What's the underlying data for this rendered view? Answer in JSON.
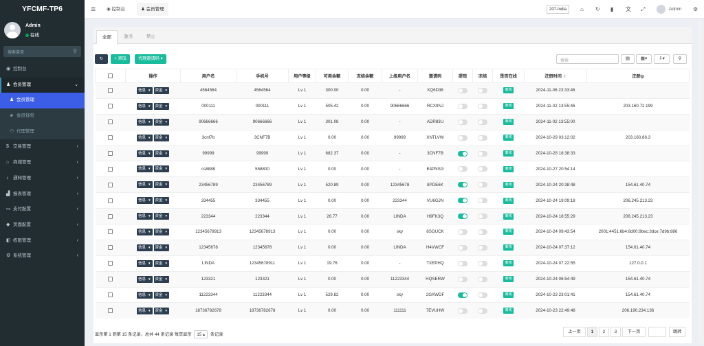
{
  "brand": "YFCMF-TP6",
  "user": {
    "name": "Admin",
    "status": "在线"
  },
  "sidebar_search": {
    "placeholder": "搜索菜单"
  },
  "menu": [
    {
      "label": "控制台",
      "icon": "dashboard-icon",
      "type": "top"
    },
    {
      "label": "会员管理",
      "icon": "user-icon",
      "type": "open"
    },
    {
      "label": "会员管理",
      "icon": "user-icon",
      "type": "active"
    },
    {
      "label": "会员钱包",
      "icon": "wallet-icon",
      "type": "sub"
    },
    {
      "label": "代理管理",
      "icon": "agent-icon",
      "type": "sub"
    },
    {
      "label": "交易管理",
      "icon": "trade-icon",
      "type": "top"
    },
    {
      "label": "商城管理",
      "icon": "shop-icon",
      "type": "top"
    },
    {
      "label": "通知管理",
      "icon": "bell-icon",
      "type": "top"
    },
    {
      "label": "报表管理",
      "icon": "chart-icon",
      "type": "top"
    },
    {
      "label": "支付配置",
      "icon": "pay-icon",
      "type": "top"
    },
    {
      "label": "页面配置",
      "icon": "page-icon",
      "type": "top"
    },
    {
      "label": "权限管理",
      "icon": "lock-icon",
      "type": "top"
    },
    {
      "label": "系统管理",
      "icon": "gear-icon",
      "type": "top"
    }
  ],
  "topbar": {
    "dashboard": "控制台",
    "current_tab": "会员管理",
    "lang": "207-India",
    "admin": "Admin"
  },
  "tabs": [
    "全部",
    "激活",
    "禁止"
  ],
  "toolbar": {
    "add": "+ 添加",
    "invite": "代理邀请码",
    "search_placeholder": "搜索"
  },
  "columns": [
    "操作",
    "用户名",
    "手机号",
    "用户等级",
    "可用余额",
    "冻结余额",
    "上级用户名",
    "邀请码",
    "提现",
    "冻结",
    "是否在线",
    "注册时间",
    "注册ip"
  ],
  "action_labels": {
    "info": "信息",
    "fund": "资金"
  },
  "online_label": "离线",
  "rows": [
    {
      "username": "4564564",
      "phone": "4564564",
      "level": "Lv 1",
      "balance": "300.00",
      "frozen": "0.00",
      "parent": "-",
      "code": "XQ6D38",
      "withdraw": false,
      "freeze": false,
      "time": "2024-11-06 23:33:46",
      "ip": ""
    },
    {
      "username": "000111",
      "phone": "000111",
      "level": "Lv 1",
      "balance": "505.42",
      "frozen": "0.00",
      "parent": "90666666",
      "code": "RCX9NJ",
      "withdraw": false,
      "freeze": false,
      "time": "2024-11-02 13:55:46",
      "ip": "203.160.72.199"
    },
    {
      "username": "90666666",
      "phone": "90666666",
      "level": "Lv 1",
      "balance": "301.08",
      "frozen": "0.00",
      "parent": "-",
      "code": "ADR83U",
      "withdraw": false,
      "freeze": false,
      "time": "2024-11-02 13:55:00",
      "ip": ""
    },
    {
      "username": "3cnf7b",
      "phone": "3CNF7B",
      "level": "Lv 1",
      "balance": "0.00",
      "frozen": "0.00",
      "parent": "99999",
      "code": "XNTLVW",
      "withdraw": false,
      "freeze": false,
      "time": "2024-10-29 03:12:02",
      "ip": "203.160.86.3"
    },
    {
      "username": "99999",
      "phone": "99999",
      "level": "Lv 1",
      "balance": "682.37",
      "frozen": "0.00",
      "parent": "-",
      "code": "3CNF7B",
      "withdraw": true,
      "freeze": false,
      "time": "2024-10-28 18:38:33",
      "ip": ""
    },
    {
      "username": "cs8888",
      "phone": "558800",
      "level": "Lv 1",
      "balance": "0.00",
      "frozen": "0.00",
      "parent": "-",
      "code": "E4PNSG",
      "withdraw": false,
      "freeze": false,
      "time": "2024-10-27 20:54:14",
      "ip": ""
    },
    {
      "username": "23456789",
      "phone": "23456789",
      "level": "Lv 1",
      "balance": "520.89",
      "frozen": "0.00",
      "parent": "12345678",
      "code": "8PDE6K",
      "withdraw": true,
      "freeze": false,
      "time": "2024-10-24 20:38:48",
      "ip": "154.61.40.74"
    },
    {
      "username": "334455",
      "phone": "334455",
      "level": "Lv 1",
      "balance": "0.00",
      "frozen": "0.00",
      "parent": "223344",
      "code": "VU6GJN",
      "withdraw": true,
      "freeze": false,
      "time": "2024-10-24 19:09:18",
      "ip": "206.245.213.23"
    },
    {
      "username": "223344",
      "phone": "223344",
      "level": "Lv 1",
      "balance": "26.77",
      "frozen": "0.00",
      "parent": "LINDA",
      "code": "H9FK3Q",
      "withdraw": true,
      "freeze": false,
      "time": "2024-10-24 18:55:29",
      "ip": "206.245.213.23"
    },
    {
      "username": "12345678913",
      "phone": "12345678913",
      "level": "Lv 1",
      "balance": "0.00",
      "frozen": "0.00",
      "parent": "sky",
      "code": "8SGUCK",
      "withdraw": false,
      "freeze": false,
      "time": "2024-10-24 09:43:54",
      "ip": "2001:4451:6b4:8d00:9bec:3dce:7d9b:886"
    },
    {
      "username": "12345678",
      "phone": "12345678",
      "level": "Lv 1",
      "balance": "0.00",
      "frozen": "0.00",
      "parent": "LINDA",
      "code": "H4VWCF",
      "withdraw": false,
      "freeze": false,
      "time": "2024-10-24 07:37:12",
      "ip": "154.61.40.74"
    },
    {
      "username": "LINDA",
      "phone": "12345678911",
      "level": "Lv 1",
      "balance": "19.76",
      "frozen": "0.00",
      "parent": "-",
      "code": "TXEPHQ",
      "withdraw": false,
      "freeze": false,
      "time": "2024-10-24 07:22:55",
      "ip": "127.0.0.1"
    },
    {
      "username": "123321",
      "phone": "123321",
      "level": "Lv 1",
      "balance": "0.00",
      "frozen": "0.00",
      "parent": "11223344",
      "code": "HQSERW",
      "withdraw": false,
      "freeze": false,
      "time": "2024-10-24 06:54:49",
      "ip": "154.61.40.74"
    },
    {
      "username": "11223344",
      "phone": "11223344",
      "level": "Lv 1",
      "balance": "529.82",
      "frozen": "0.00",
      "parent": "sky",
      "code": "2GXWDF",
      "withdraw": true,
      "freeze": false,
      "time": "2024-10-23 23:01:41",
      "ip": "154.61.40.74"
    },
    {
      "username": "18736782678",
      "phone": "18736782678",
      "level": "Lv 1",
      "balance": "0.00",
      "frozen": "0.00",
      "parent": "111111",
      "code": "7EVUHW",
      "withdraw": false,
      "freeze": false,
      "time": "2024-10-23 22:49:48",
      "ip": "206.190.234.136"
    }
  ],
  "footer": {
    "info_prefix": "显示第 1 到第 15 条记录，总共 44 条记录 每页显示",
    "page_size": "15",
    "info_suffix": "条记录"
  },
  "pagination": {
    "prev": "上一页",
    "pages": [
      "1",
      "2",
      "3"
    ],
    "next": "下一页",
    "jump": "跳转"
  }
}
